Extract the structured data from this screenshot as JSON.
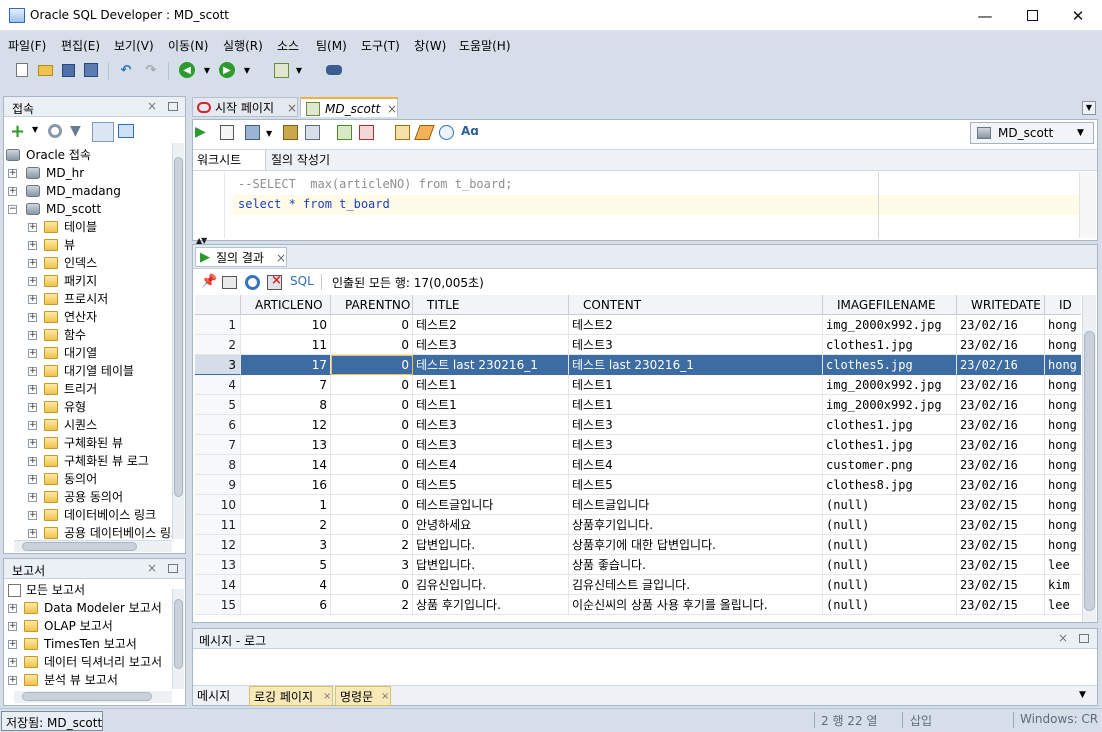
{
  "window": {
    "title": "Oracle SQL Developer : MD_scott"
  },
  "menu": [
    "파일(F)",
    "편집(E)",
    "보기(V)",
    "이동(N)",
    "실행(R)",
    "소스",
    "팀(M)",
    "도구(T)",
    "창(W)",
    "도움말(H)"
  ],
  "connections_panel": {
    "title": "접속",
    "root": "Oracle 접속",
    "connections": [
      "MD_hr",
      "MD_madang",
      "MD_scott"
    ],
    "scott_children": [
      "테이블",
      "뷰",
      "인덱스",
      "패키지",
      "프로시저",
      "연산자",
      "함수",
      "대기열",
      "대기열 테이블",
      "트리거",
      "유형",
      "시퀀스",
      "구체화된 뷰",
      "구체화된 뷰 로그",
      "동의어",
      "공용 동의어",
      "데이터베이스 링크",
      "공용 데이터베이스 링크"
    ]
  },
  "reports_panel": {
    "title": "보고서",
    "root": "모든 보고서",
    "items": [
      "Data Modeler 보고서",
      "OLAP 보고서",
      "TimesTen 보고서",
      "데이터 딕셔너리 보고서",
      "분석 뷰 보고서"
    ]
  },
  "editor_tabs": [
    "시작 페이지",
    "MD_scott"
  ],
  "connection_selector": "MD_scott",
  "worksheet_tabs": [
    "워크시트",
    "질의 작성기"
  ],
  "sql_lines": [
    "--SELECT  max(articleNO) from t_board;",
    "select * from t_board"
  ],
  "results": {
    "tab_label": "질의 결과",
    "sql_label": "SQL",
    "status": "인출된 모든 행: 17(0,005초)",
    "columns": [
      "ARTICLENO",
      "PARENTNO",
      "TITLE",
      "CONTENT",
      "IMAGEFILENAME",
      "WRITEDATE",
      "ID"
    ],
    "selected_row": 3,
    "rows": [
      [
        "1",
        "10",
        "0",
        "테스트2",
        "테스트2",
        "img_2000x992.jpg",
        "23/02/16",
        "hong"
      ],
      [
        "2",
        "11",
        "0",
        "테스트3",
        "테스트3",
        "clothes1.jpg",
        "23/02/16",
        "hong"
      ],
      [
        "3",
        "17",
        "0",
        "테스트 last 230216_1",
        "테스트 last 230216_1",
        "clothes5.jpg",
        "23/02/16",
        "hong"
      ],
      [
        "4",
        "7",
        "0",
        "테스트1",
        "테스트1",
        "img_2000x992.jpg",
        "23/02/16",
        "hong"
      ],
      [
        "5",
        "8",
        "0",
        "테스트1",
        "테스트1",
        "img_2000x992.jpg",
        "23/02/16",
        "hong"
      ],
      [
        "6",
        "12",
        "0",
        "테스트3",
        "테스트3",
        "clothes1.jpg",
        "23/02/16",
        "hong"
      ],
      [
        "7",
        "13",
        "0",
        "테스트3",
        "테스트3",
        "clothes1.jpg",
        "23/02/16",
        "hong"
      ],
      [
        "8",
        "14",
        "0",
        "테스트4",
        "테스트4",
        "customer.png",
        "23/02/16",
        "hong"
      ],
      [
        "9",
        "16",
        "0",
        "테스트5",
        "테스트5",
        "clothes8.jpg",
        "23/02/16",
        "hong"
      ],
      [
        "10",
        "1",
        "0",
        "테스트글입니다",
        "테스트글입니다",
        "(null)",
        "23/02/15",
        "hong"
      ],
      [
        "11",
        "2",
        "0",
        "안녕하세요",
        "상품후기입니다.",
        "(null)",
        "23/02/15",
        "hong"
      ],
      [
        "12",
        "3",
        "2",
        "답변입니다.",
        "상품후기에 대한 답변입니다.",
        "(null)",
        "23/02/15",
        "hong"
      ],
      [
        "13",
        "5",
        "3",
        "답변입니다.",
        "상품 좋습니다.",
        "(null)",
        "23/02/15",
        "lee"
      ],
      [
        "14",
        "4",
        "0",
        "김유신입니다.",
        "김유신테스트 글입니다.",
        "(null)",
        "23/02/15",
        "kim"
      ],
      [
        "15",
        "6",
        "2",
        "상품 후기입니다.",
        "이순신씨의 상품 사용 후기를 올립니다.",
        "(null)",
        "23/02/15",
        "lee"
      ]
    ]
  },
  "message_panel": {
    "title": "메시지 - 로그",
    "tabs": [
      "메시지",
      "로깅 페이지",
      "명령문"
    ]
  },
  "statusbar": {
    "left": "저장됨: MD_scott",
    "position": "2 행 22 열",
    "mode": "삽입",
    "eol": "Windows: CR"
  }
}
